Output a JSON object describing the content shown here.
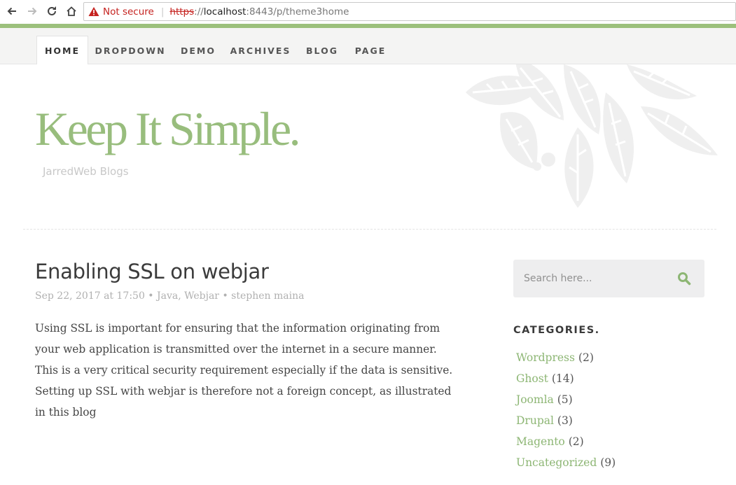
{
  "browser": {
    "security_label": "Not secure",
    "url_protocol": "https",
    "url_sep": "://",
    "url_host": "localhost",
    "url_rest": ":8443/p/theme3home"
  },
  "menu": {
    "items": [
      {
        "label": "HOME",
        "active": true
      },
      {
        "label": "DROPDOWN"
      },
      {
        "label": "DEMO"
      },
      {
        "label": "ARCHIVES"
      },
      {
        "label": "BLOG"
      },
      {
        "label": "PAGE"
      }
    ]
  },
  "header": {
    "title": "Keep It Simple.",
    "subtitle": "JarredWeb Blogs"
  },
  "post": {
    "title": "Enabling SSL on webjar",
    "meta": "Sep 22, 2017 at 17:50 • Java, Webjar • stephen maina",
    "excerpt": "Using SSL is important for ensuring that the information originating from your web application is transmitted over the internet in a secure manner. This is a very critical security requirement especially if the data is sensitive. Setting up SSL with webjar is therefore not a foreign concept, as illustrated in this blog"
  },
  "sidebar": {
    "search_placeholder": "Search here...",
    "categories_title": "CATEGORIES.",
    "categories": [
      {
        "name": "Wordpress",
        "count": "(2)"
      },
      {
        "name": "Ghost",
        "count": "(14)"
      },
      {
        "name": "Joomla",
        "count": "(5)"
      },
      {
        "name": "Drupal",
        "count": "(3)"
      },
      {
        "name": "Magento",
        "count": "(2)"
      },
      {
        "name": "Uncategorized",
        "count": "(9)"
      }
    ]
  },
  "colors": {
    "accent": "#98bd7d",
    "warning": "#c5221f"
  }
}
